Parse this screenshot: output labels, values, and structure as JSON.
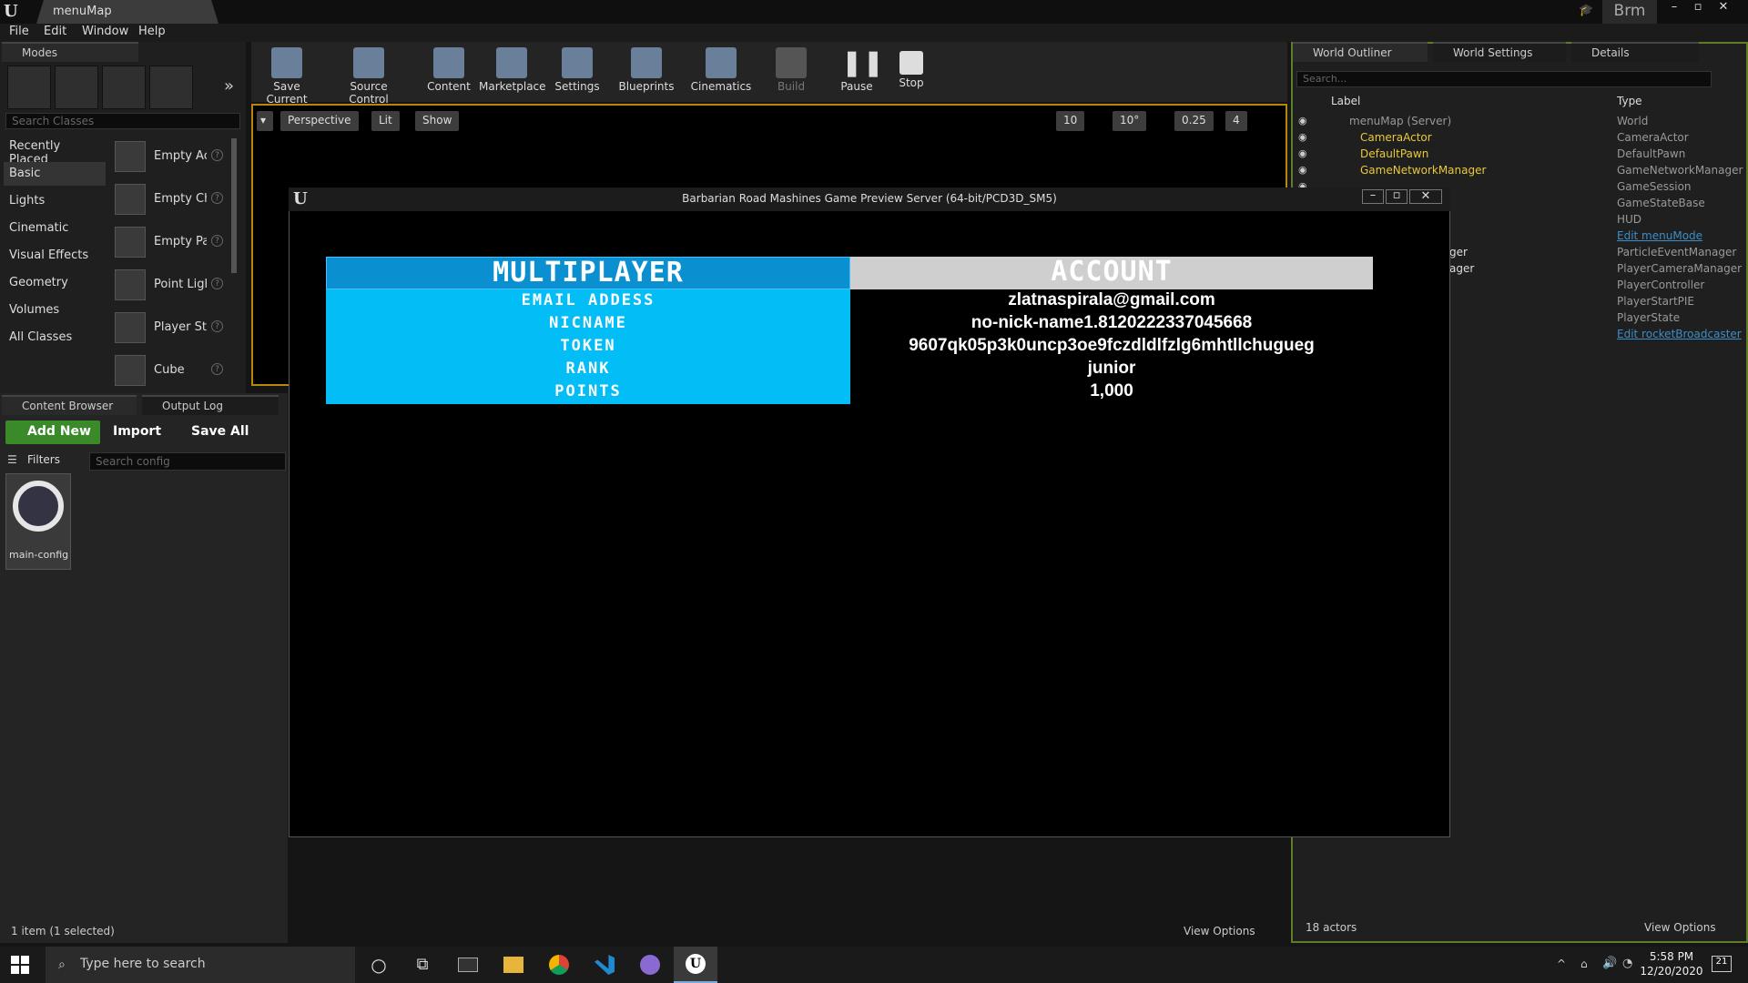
{
  "app": {
    "tab": "menuMap",
    "user": "Brm"
  },
  "menu": [
    "File",
    "Edit",
    "Window",
    "Help"
  ],
  "modes": {
    "tab": "Modes",
    "search_placeholder": "Search Classes",
    "categories": [
      "Recently Placed",
      "Basic",
      "Lights",
      "Cinematic",
      "Visual Effects",
      "Geometry",
      "Volumes",
      "All Classes"
    ],
    "items": [
      "Empty Actor",
      "Empty Character",
      "Empty Pawn",
      "Point Light",
      "Player Start",
      "Cube"
    ]
  },
  "toolbar": [
    "Save Current",
    "Source Control",
    "Content",
    "Marketplace",
    "Settings",
    "Blueprints",
    "Cinematics",
    "Build",
    "Pause",
    "Stop"
  ],
  "viewport": {
    "perspective": "Perspective",
    "lit": "Lit",
    "show": "Show",
    "grid": "10",
    "rot": "10°",
    "scale": "0.25",
    "cam": "4"
  },
  "content_browser": {
    "tab": "Content Browser",
    "output_tab": "Output Log",
    "add_new": "Add New",
    "import": "Import",
    "save_all": "Save All",
    "filters": "Filters",
    "search_placeholder": "Search config",
    "asset": "main-config",
    "count": "1 item (1 selected)",
    "view_options": "View Options"
  },
  "outliner": {
    "tabs": [
      "World Outliner",
      "World Settings",
      "Details"
    ],
    "search_placeholder": "Search...",
    "col_label": "Label",
    "col_type": "Type",
    "rows": [
      {
        "label": "menuMap (Server)",
        "type": "World"
      },
      {
        "label": "CameraActor",
        "type": "CameraActor"
      },
      {
        "label": "DefaultPawn",
        "type": "DefaultPawn"
      },
      {
        "label": "GameNetworkManager",
        "type": "GameNetworkManager"
      },
      {
        "label": "",
        "type": "GameSession"
      },
      {
        "label": "",
        "type": "GameStateBase"
      },
      {
        "label": "",
        "type": "HUD"
      },
      {
        "label": "",
        "type": "Edit menuMode"
      },
      {
        "label": "ger",
        "type": "ParticleEventManager"
      },
      {
        "label": "ager",
        "type": "PlayerCameraManager"
      },
      {
        "label": "",
        "type": "PlayerController"
      },
      {
        "label": "",
        "type": "PlayerStartPIE"
      },
      {
        "label": "",
        "type": "PlayerState"
      },
      {
        "label": "",
        "type": "Edit rocketBroadcaster"
      }
    ],
    "actors": "18 actors",
    "view_options": "View Options"
  },
  "game": {
    "title": "Barbarian Road Mashines Game Preview Server (64-bit/PCD3D_SM5)",
    "mp_header": "MULTIPLAYER",
    "acc_header": "ACCOUNT",
    "labels": [
      "EMAIL ADDESS",
      "NICNAME",
      "TOKEN",
      "RANK",
      "POINTS"
    ],
    "values": [
      "zlatnaspirala@gmail.com",
      "no-nick-name1.8120222337045668",
      "9607qk05p3k0uncp3oe9fczdldlfzlg6mhtllchugueg",
      "junior",
      "1,000"
    ]
  },
  "taskbar": {
    "search": "Type here to search",
    "time": "5:58 PM",
    "date": "12/20/2020",
    "notif": "21"
  }
}
